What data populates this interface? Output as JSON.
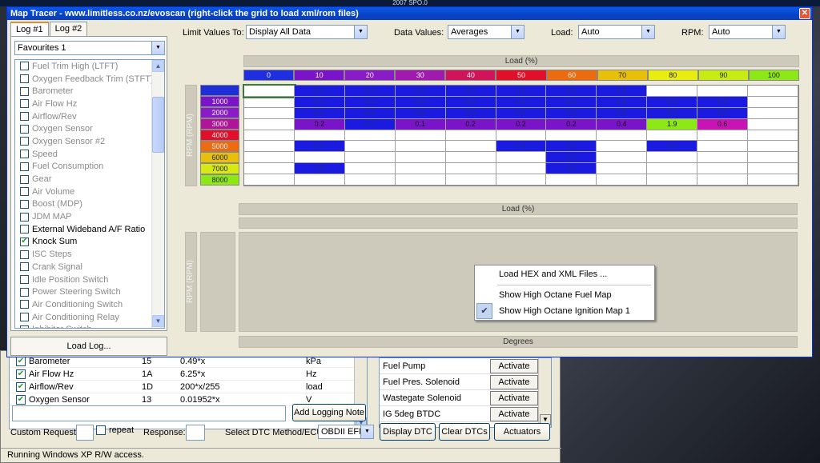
{
  "desktop_title": "2007 SPO.0",
  "window": {
    "title": "Map Tracer - www.limitless.co.nz/evoscan (right-click the grid to load xml/rom files)",
    "close_glyph": "✕"
  },
  "tabs": [
    "Log #1",
    "Log #2"
  ],
  "favourites": "Favourites 1",
  "channels": [
    {
      "label": "Fuel Trim High (LTFT)",
      "checked": false,
      "dim": true
    },
    {
      "label": "Oxygen Feedback Trim (STFT)",
      "checked": false,
      "dim": true
    },
    {
      "label": "Barometer",
      "checked": false,
      "dim": true
    },
    {
      "label": "Air Flow Hz",
      "checked": false,
      "dim": true
    },
    {
      "label": "Airflow/Rev",
      "checked": false,
      "dim": true
    },
    {
      "label": "Oxygen Sensor",
      "checked": false,
      "dim": true
    },
    {
      "label": "Oxygen Sensor #2",
      "checked": false,
      "dim": true
    },
    {
      "label": "Speed",
      "checked": false,
      "dim": true
    },
    {
      "label": "Fuel Consumption",
      "checked": false,
      "dim": true
    },
    {
      "label": "Gear",
      "checked": false,
      "dim": true
    },
    {
      "label": "Air Volume",
      "checked": false,
      "dim": true
    },
    {
      "label": "Boost (MDP)",
      "checked": false,
      "dim": true
    },
    {
      "label": "JDM MAP",
      "checked": false,
      "dim": true
    },
    {
      "label": "External Wideband A/F Ratio",
      "checked": false,
      "dim": false
    },
    {
      "label": "Knock Sum",
      "checked": true,
      "dim": false
    },
    {
      "label": "ISC Steps",
      "checked": false,
      "dim": true
    },
    {
      "label": "Crank Signal",
      "checked": false,
      "dim": true
    },
    {
      "label": "Idle Position Switch",
      "checked": false,
      "dim": true
    },
    {
      "label": "Power Steering Switch",
      "checked": false,
      "dim": true
    },
    {
      "label": "Air Conditioning Switch",
      "checked": false,
      "dim": true
    },
    {
      "label": "Air Conditioning Relay",
      "checked": false,
      "dim": true
    },
    {
      "label": "Inhibitor Switch",
      "checked": false,
      "dim": true
    }
  ],
  "load_log_label": "Load Log...",
  "controls": {
    "limit_label": "Limit Values To:",
    "limit_value": "Display All Data",
    "data_label": "Data Values:",
    "data_value": "Averages",
    "load_label": "Load:",
    "load_value": "Auto",
    "rpm_label": "RPM:",
    "rpm_value": "Auto"
  },
  "grid": {
    "load_header": "Load (%)",
    "rpm_header": "RPM (RPM)",
    "load_axis": [
      "0",
      "10",
      "20",
      "30",
      "40",
      "50",
      "60",
      "70",
      "80",
      "90",
      "100"
    ],
    "load_colors": [
      "#1f2fe0",
      "#7a14c8",
      "#8a1cc8",
      "#a01ab0",
      "#d0145a",
      "#e0102a",
      "#ec6a10",
      "#e8c00c",
      "#e8ec10",
      "#c6ec14",
      "#8ee818"
    ],
    "rpm_axis": [
      "",
      "1000",
      "2000",
      "3000",
      "4000",
      "5000",
      "6000",
      "7000",
      "8000"
    ],
    "rpm_colors": [
      "#1e2fd8",
      "#7a14c8",
      "#8a1cc8",
      "#b01498",
      "#e0102a",
      "#ec6a10",
      "#e8c00c",
      "#d8e812",
      "#8ee818"
    ],
    "values": [
      [
        "",
        "0.0",
        "0.0",
        "0.0",
        "0.0",
        "0.0",
        "0.0",
        "0.0",
        "",
        "",
        ""
      ],
      [
        "",
        "0.0",
        "0.0",
        "0.0",
        "0.0",
        "0.0",
        "0.0",
        "0.0",
        "0.0",
        "0.0",
        ""
      ],
      [
        "",
        "0.0",
        "0.0",
        "0.0",
        "0.0",
        "0.0",
        "0.0",
        "0.0",
        "0.1",
        "0.0",
        ""
      ],
      [
        "",
        "0.2",
        "0.0",
        "0.1",
        "0.2",
        "0.2",
        "0.2",
        "0.4",
        "1.9",
        "0.6",
        ""
      ],
      [
        "",
        "",
        "",
        "",
        "",
        "",
        "",
        "",
        "",
        "",
        ""
      ],
      [
        "",
        "0.0",
        "",
        "",
        "",
        "0.0",
        "0.0",
        "",
        "0.0",
        "",
        ""
      ],
      [
        "",
        "",
        "",
        "",
        "",
        "",
        "0.0",
        "",
        "",
        "",
        ""
      ],
      [
        "",
        "0.0",
        "",
        "",
        "",
        "",
        "0.0",
        "",
        "",
        "",
        ""
      ],
      [
        "",
        "",
        "",
        "",
        "",
        "",
        "",
        "",
        "",
        "",
        ""
      ]
    ],
    "colors": {
      "blue": "#1a1ae0",
      "purple": "#7a14c8",
      "magenta": "#c814b4",
      "green": "#8ee818"
    },
    "second_header": "Load (%)",
    "second_rpm_header": "RPM (RPM)",
    "footer_label": "Degrees"
  },
  "context_menu": {
    "items": [
      "Load HEX and XML Files ...",
      "Show High Octane Fuel Map",
      "Show High Octane Ignition Map 1"
    ],
    "checked_glyph": "✔"
  },
  "bg_table": [
    {
      "name": "Barometer",
      "id": "15",
      "formula": "0.49*x",
      "unit": "kPa"
    },
    {
      "name": "Air Flow Hz",
      "id": "1A",
      "formula": "6.25*x",
      "unit": "Hz"
    },
    {
      "name": "Airflow/Rev",
      "id": "1D",
      "formula": "200*x/255",
      "unit": "load"
    },
    {
      "name": "Oxygen Sensor",
      "id": "13",
      "formula": "0.01952*x",
      "unit": "V"
    }
  ],
  "actuators": [
    {
      "name": "Fuel Pump",
      "btn": "Activate"
    },
    {
      "name": "Fuel Pres. Solenoid",
      "btn": "Activate"
    },
    {
      "name": "Wastegate Solenoid",
      "btn": "Activate"
    },
    {
      "name": "IG 5deg BTDC",
      "btn": "Activate"
    }
  ],
  "bottom": {
    "add_note": "Add Logging Note",
    "custom_request": "Custom Request:",
    "repeat": "repeat",
    "response": "Response:",
    "dtc_label": "Select DTC Method/ECU:",
    "dtc_value": "OBDII EFI",
    "display_dtc": "Display DTC",
    "clear_dtc": "Clear DTCs",
    "actuators": "Actuators",
    "status": "Running Windows XP  R/W access."
  }
}
